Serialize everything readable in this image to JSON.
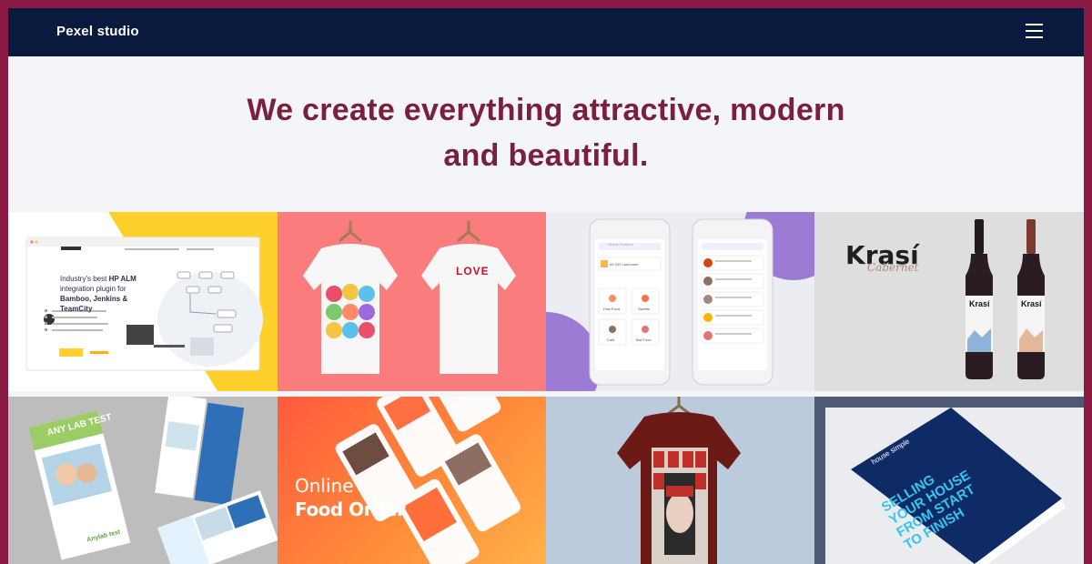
{
  "navbar": {
    "brand": "Pexel studio",
    "menu_icon": "hamburger-icon"
  },
  "hero": {
    "headline_line1": "We create everything attractive, modern",
    "headline_line2": "and beautiful."
  },
  "colors": {
    "frame": "#8b1a45",
    "navbar": "#0a1a3f",
    "headline": "#7a1f3c"
  },
  "portfolio": {
    "tile1": {
      "headline_1": "Industry's best",
      "headline_bold": "HP ALM",
      "headline_2": "integration plugin for",
      "headline_3": "Bamboo, Jenkins &",
      "headline_4": "TeamCity"
    },
    "tile2": {
      "shirt_text": "LOVE"
    },
    "tile3": {
      "brand": "Ire 200 Lanhouse",
      "cat1": "Fast Food",
      "cat2": "Sweets",
      "cat3": "Cafe",
      "cat4": "Bar Food",
      "search": "Search Product"
    },
    "tile4": {
      "brand": "Krasí",
      "script": "Cabernet"
    },
    "tile5": {
      "brochure_title": "ANY LAB TEST",
      "brochure_footer": "Anylab test"
    },
    "tile6": {
      "line1": "Online",
      "line2": "Food Order"
    },
    "tile7": {},
    "tile8": {
      "logo": "house simple",
      "headline": "SELLING YOUR HOUSE FROM START TO FINISH"
    }
  }
}
